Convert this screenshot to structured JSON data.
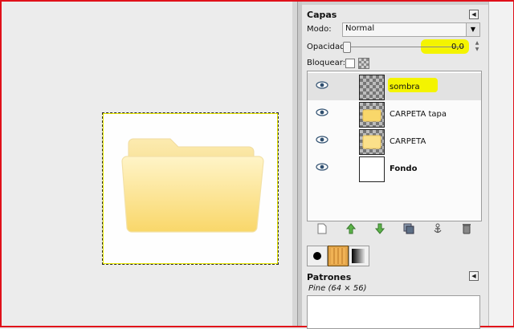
{
  "layers_panel": {
    "title": "Capas",
    "mode_label": "Modo:",
    "mode_value": "Normal",
    "opacity_label": "Opacidad:",
    "opacity_value": "0,0",
    "opacity_fraction": 0.0,
    "lock_label": "Bloquear:",
    "layers": [
      {
        "name": "sombra",
        "selected": true,
        "highlighted": true
      },
      {
        "name": "CARPETA tapa",
        "selected": false
      },
      {
        "name": "CARPETA",
        "selected": false
      },
      {
        "name": "Fondo",
        "selected": false,
        "bold": true
      }
    ],
    "buttons": [
      "new-layer-icon",
      "raise-layer-icon",
      "lower-layer-icon",
      "duplicate-layer-icon",
      "anchor-icon",
      "delete-layer-icon"
    ]
  },
  "patterns_panel": {
    "title": "Patrones",
    "pattern_name": "Pine (64 × 56)",
    "tabs": [
      "brushes-tab-icon",
      "patterns-tab-icon",
      "gradients-tab-icon"
    ]
  },
  "colors": {
    "highlight": "#f4f400",
    "frame_border": "#e0101a",
    "folder_fill": "#fde28a"
  }
}
